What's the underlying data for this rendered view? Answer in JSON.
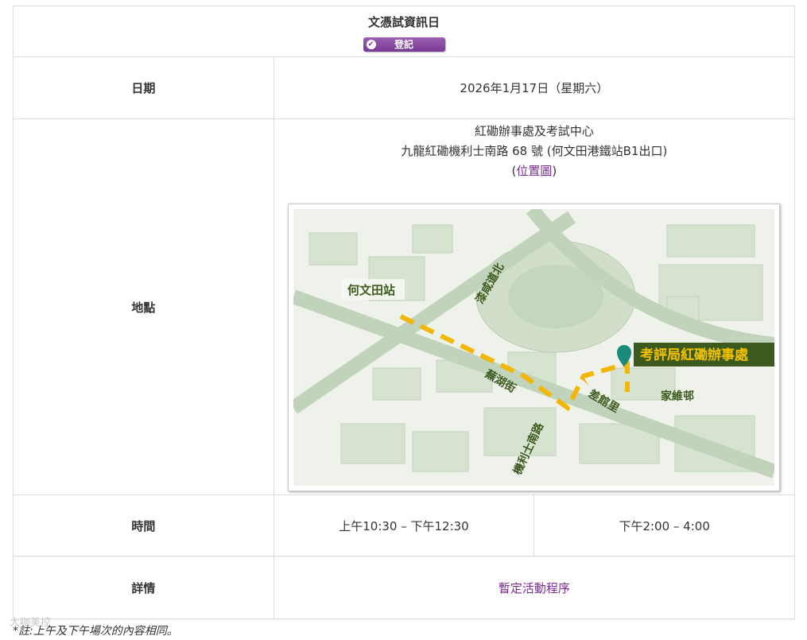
{
  "header": {
    "title": "文憑試資訊日",
    "register_label": "登記"
  },
  "rows": {
    "date": {
      "label": "日期",
      "value": "2026年1月17日（星期六）"
    },
    "location": {
      "label": "地點",
      "line1": "紅磡辦事處及考試中心",
      "line2": "九龍紅磡機利士南路 68 號 (何文田港鐵站B1出口)",
      "map_open": "(",
      "map_link": "位置圖",
      "map_close": ")"
    },
    "time": {
      "label": "時間",
      "morning": "上午10:30 – 下午12:30",
      "afternoon": "下午2:00 – 4:00"
    },
    "details": {
      "label": "詳情",
      "link": "暫定活動程序"
    }
  },
  "map": {
    "station": "何文田站",
    "office": "考評局紅磡辦事處",
    "road_1": "漆咸道北",
    "road_2": "蕪湖街",
    "road_3": "機利士南路",
    "road_4": "差館里",
    "estate": "家維邨",
    "colors": {
      "road": "#c9d8c3",
      "block": "#d5e2cf",
      "route": "#f2b705",
      "label_bg": "#3d5a1e",
      "label_text": "#f2c200",
      "marker": "#1a8a7a"
    }
  },
  "footer": {
    "note": "*註:上午及下午場次的內容相同。",
    "watermark": "大咖美控"
  }
}
